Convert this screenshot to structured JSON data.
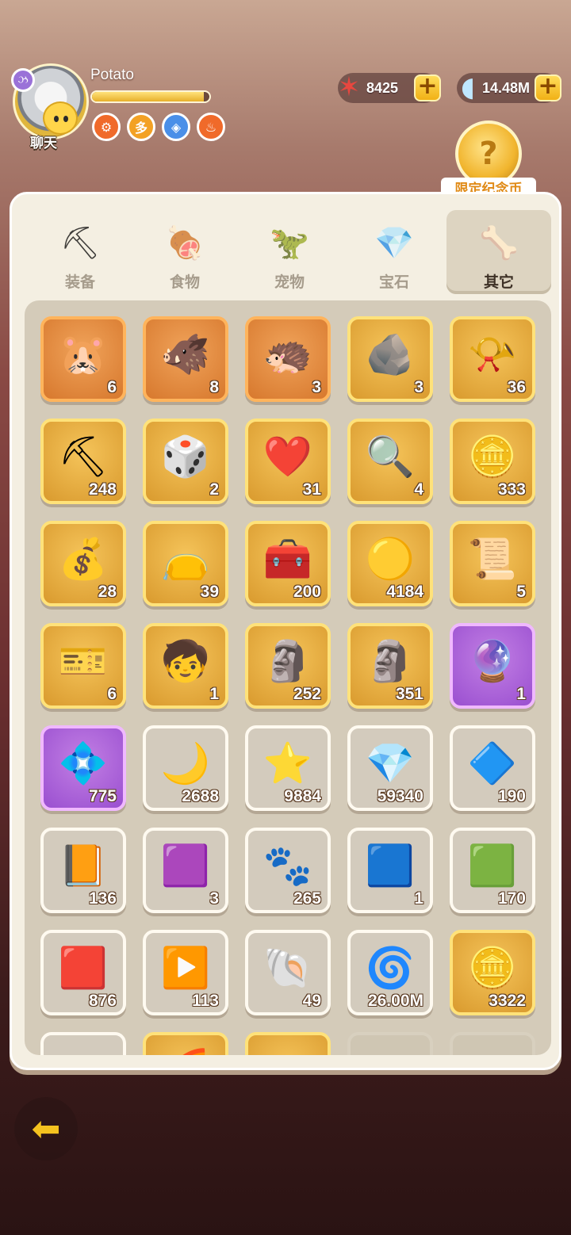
{
  "player": {
    "name": "Potato",
    "level_badge": "ઝ",
    "xp_progress": 0.95
  },
  "chat": {
    "label": "聊天"
  },
  "badges": [
    {
      "name": "gear-medal",
      "glyph": "⚙",
      "color": "#f06a2a"
    },
    {
      "name": "pet-medal",
      "glyph": "多",
      "color": "#f3a124"
    },
    {
      "name": "gem-medal",
      "glyph": "◈",
      "color": "#4a8fe8"
    },
    {
      "name": "food-medal",
      "glyph": "♨",
      "color": "#f06a2a"
    }
  ],
  "resources": {
    "starfish": {
      "value": "8425",
      "icon": "starfish-icon"
    },
    "shell": {
      "value": "14.48M",
      "icon": "shell-icon"
    }
  },
  "limited_coin": {
    "label": "限定纪念币"
  },
  "tabs": [
    {
      "label": "装备",
      "icon": "pickaxe-icon",
      "glyph": "⛏",
      "active": false
    },
    {
      "label": "食物",
      "icon": "food-bowl-icon",
      "glyph": "🍖",
      "active": false
    },
    {
      "label": "宠物",
      "icon": "dino-skull-icon",
      "glyph": "🦖",
      "active": false
    },
    {
      "label": "宝石",
      "icon": "gem-icon",
      "glyph": "💎",
      "active": false
    },
    {
      "label": "其它",
      "icon": "bone-icon",
      "glyph": "🦴",
      "active": true
    }
  ],
  "items": [
    {
      "name": "pet-crystal-1",
      "rarity": "orange",
      "glyph": "🐹",
      "count": "6"
    },
    {
      "name": "pet-crystal-2",
      "rarity": "orange",
      "glyph": "🐗",
      "count": "8"
    },
    {
      "name": "pet-crystal-3",
      "rarity": "orange",
      "glyph": "🦔",
      "count": "3"
    },
    {
      "name": "gold-ore",
      "rarity": "gold",
      "glyph": "🪨",
      "count": "3"
    },
    {
      "name": "horn",
      "rarity": "gold",
      "glyph": "📯",
      "count": "36"
    },
    {
      "name": "pickaxe",
      "rarity": "gold",
      "glyph": "⛏",
      "count": "248"
    },
    {
      "name": "dice",
      "rarity": "gold",
      "glyph": "🎲",
      "count": "2"
    },
    {
      "name": "heart",
      "rarity": "gold",
      "glyph": "❤️",
      "count": "31"
    },
    {
      "name": "magnifier",
      "rarity": "gold",
      "glyph": "🔍",
      "count": "4"
    },
    {
      "name": "cake-coin",
      "rarity": "gold",
      "glyph": "🪙",
      "count": "333"
    },
    {
      "name": "green-bag",
      "rarity": "gold",
      "glyph": "💰",
      "count": "28"
    },
    {
      "name": "purple-bag",
      "rarity": "gold",
      "glyph": "👝",
      "count": "39"
    },
    {
      "name": "treasure-chest",
      "rarity": "gold",
      "glyph": "🧰",
      "count": "200"
    },
    {
      "name": "spiral-coin",
      "rarity": "gold",
      "glyph": "🟡",
      "count": "4184"
    },
    {
      "name": "map-scroll",
      "rarity": "gold",
      "glyph": "📜",
      "count": "5"
    },
    {
      "name": "blue-ticket",
      "rarity": "gold",
      "glyph": "🎫",
      "count": "6"
    },
    {
      "name": "character-token",
      "rarity": "gold",
      "glyph": "🧒",
      "count": "1"
    },
    {
      "name": "green-idol",
      "rarity": "gold",
      "glyph": "🗿",
      "count": "252"
    },
    {
      "name": "stone-idol",
      "rarity": "gold",
      "glyph": "🗿",
      "count": "351"
    },
    {
      "name": "purple-gem",
      "rarity": "purple",
      "glyph": "🔮",
      "count": "1"
    },
    {
      "name": "pink-crystal",
      "rarity": "purple",
      "glyph": "💠",
      "count": "775"
    },
    {
      "name": "moon-stone",
      "rarity": "white",
      "glyph": "🌙",
      "count": "2688"
    },
    {
      "name": "star-stone",
      "rarity": "white",
      "glyph": "⭐",
      "count": "9884"
    },
    {
      "name": "blue-crystal",
      "rarity": "white",
      "glyph": "💎",
      "count": "59340"
    },
    {
      "name": "rune-stone",
      "rarity": "white",
      "glyph": "🔷",
      "count": "190"
    },
    {
      "name": "orange-scroll",
      "rarity": "white",
      "glyph": "📙",
      "count": "136"
    },
    {
      "name": "purple-card",
      "rarity": "white",
      "glyph": "🟪",
      "count": "3"
    },
    {
      "name": "paw-card",
      "rarity": "white",
      "glyph": "🐾",
      "count": "265"
    },
    {
      "name": "blue-card",
      "rarity": "white",
      "glyph": "🟦",
      "count": "1"
    },
    {
      "name": "green-card",
      "rarity": "white",
      "glyph": "🟩",
      "count": "170"
    },
    {
      "name": "red-card",
      "rarity": "white",
      "glyph": "🟥",
      "count": "876"
    },
    {
      "name": "play-card",
      "rarity": "white",
      "glyph": "▶️",
      "count": "113"
    },
    {
      "name": "shell-coin",
      "rarity": "white",
      "glyph": "🐚",
      "count": "49"
    },
    {
      "name": "spiral-stone",
      "rarity": "white",
      "glyph": "🌀",
      "count": "26.00M"
    },
    {
      "name": "gold-coin",
      "rarity": "gold",
      "glyph": "🪙",
      "count": "3322"
    },
    {
      "name": "partial-1",
      "rarity": "white",
      "glyph": "",
      "count": ""
    },
    {
      "name": "partial-2",
      "rarity": "gold",
      "glyph": "🌈",
      "count": ""
    },
    {
      "name": "partial-3",
      "rarity": "gold",
      "glyph": "",
      "count": ""
    },
    {
      "name": "empty-1",
      "rarity": "empty",
      "glyph": "",
      "count": ""
    },
    {
      "name": "empty-2",
      "rarity": "empty",
      "glyph": "",
      "count": ""
    }
  ],
  "back": {
    "icon": "back-arrow-icon",
    "glyph": "⬅"
  }
}
